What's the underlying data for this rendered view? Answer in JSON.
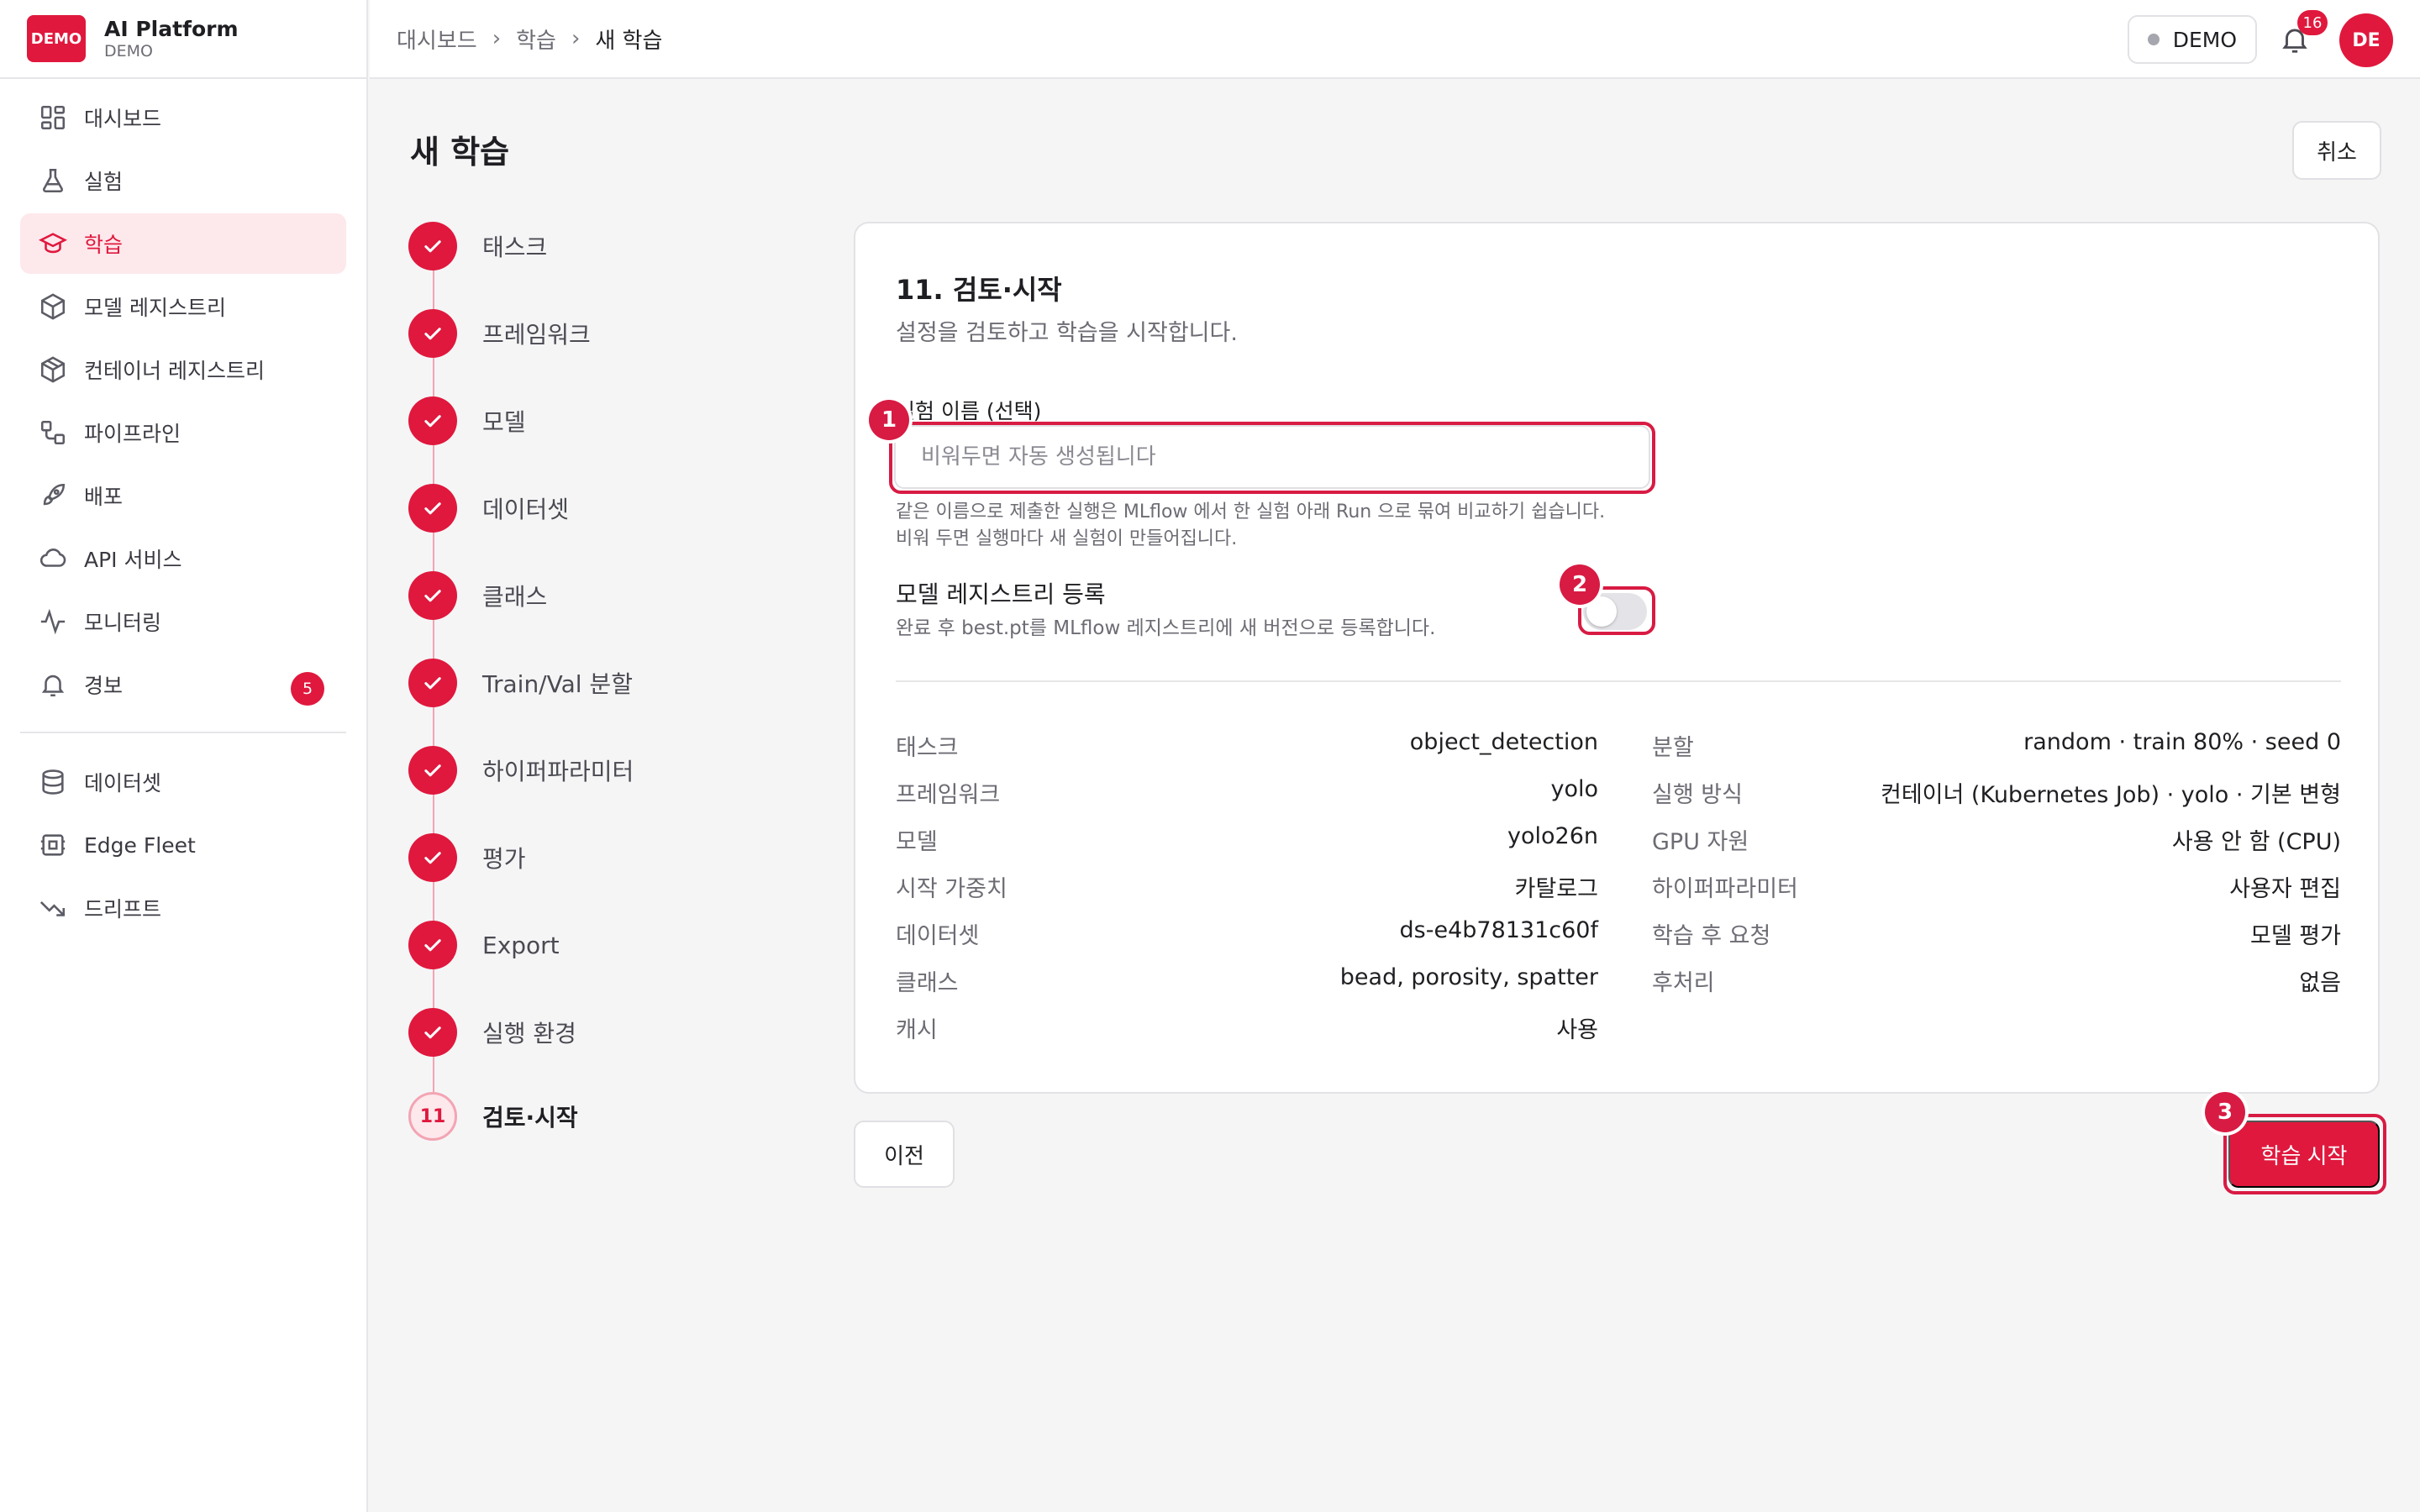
{
  "brand": {
    "logo": "DEMO",
    "title": "AI Platform",
    "subtitle": "DEMO"
  },
  "sidebar": {
    "items": [
      {
        "label": "대시보드",
        "icon": "dashboard-icon"
      },
      {
        "label": "실험",
        "icon": "flask-icon"
      },
      {
        "label": "학습",
        "icon": "graduation-cap-icon",
        "active": true
      },
      {
        "label": "모델 레지스트리",
        "icon": "cube-icon"
      },
      {
        "label": "컨테이너 레지스트리",
        "icon": "container-icon"
      },
      {
        "label": "파이프라인",
        "icon": "pipeline-icon"
      },
      {
        "label": "배포",
        "icon": "rocket-icon"
      },
      {
        "label": "API 서비스",
        "icon": "cloud-icon"
      },
      {
        "label": "모니터링",
        "icon": "activity-icon"
      },
      {
        "label": "경보",
        "icon": "bell-icon",
        "badge": "5"
      }
    ],
    "secondary": [
      {
        "label": "데이터셋",
        "icon": "database-icon"
      },
      {
        "label": "Edge Fleet",
        "icon": "edge-device-icon"
      },
      {
        "label": "드리프트",
        "icon": "trend-down-icon"
      }
    ]
  },
  "header": {
    "breadcrumb": [
      "대시보드",
      "학습",
      "새 학습"
    ],
    "env_label": "DEMO",
    "notification_count": "16",
    "avatar": "DE"
  },
  "page": {
    "title": "새 학습",
    "cancel_label": "취소"
  },
  "steps": [
    {
      "label": "태스크",
      "status": "done"
    },
    {
      "label": "프레임워크",
      "status": "done"
    },
    {
      "label": "모델",
      "status": "done"
    },
    {
      "label": "데이터셋",
      "status": "done"
    },
    {
      "label": "클래스",
      "status": "done"
    },
    {
      "label": "Train/Val 분할",
      "status": "done"
    },
    {
      "label": "하이퍼파라미터",
      "status": "done"
    },
    {
      "label": "평가",
      "status": "done"
    },
    {
      "label": "Export",
      "status": "done"
    },
    {
      "label": "실행 환경",
      "status": "done"
    },
    {
      "label": "검토·시작",
      "status": "current",
      "number": "11"
    }
  ],
  "review": {
    "title": "11. 검토·시작",
    "subtitle": "설정을 검토하고 학습을 시작합니다.",
    "name_label": "실험 이름 (선택)",
    "name_value": "",
    "name_placeholder": "비워두면 자동 생성됩니다",
    "name_hint_1": "같은 이름으로 제출한 실행은 MLflow 에서 한 실험 아래 Run 으로 묶여 비교하기 쉽습니다.",
    "name_hint_2": "비워 두면 실행마다 새 실험이 만들어집니다.",
    "registry_title": "모델 레지스트리 등록",
    "registry_desc": "완료 후 best.pt를 MLflow 레지스트리에 새 버전으로 등록합니다.",
    "registry_enabled": false,
    "summary_left": [
      {
        "key": "태스크",
        "value": "object_detection"
      },
      {
        "key": "프레임워크",
        "value": "yolo"
      },
      {
        "key": "모델",
        "value": "yolo26n"
      },
      {
        "key": "시작 가중치",
        "value": "카탈로그"
      },
      {
        "key": "데이터셋",
        "value": "ds-e4b78131c60f"
      },
      {
        "key": "클래스",
        "value": "bead, porosity, spatter"
      },
      {
        "key": "캐시",
        "value": "사용"
      }
    ],
    "summary_right": [
      {
        "key": "분할",
        "value": "random · train 80% · seed 0"
      },
      {
        "key": "실행 방식",
        "value": "컨테이너 (Kubernetes Job) · yolo · 기본 변형"
      },
      {
        "key": "GPU 자원",
        "value": "사용 안 함 (CPU)"
      },
      {
        "key": "하이퍼파라미터",
        "value": "사용자 편집"
      },
      {
        "key": "학습 후 요청",
        "value": "모델 평가"
      },
      {
        "key": "후처리",
        "value": "없음"
      }
    ]
  },
  "actions": {
    "prev_label": "이전",
    "start_label": "학습 시작"
  },
  "annotations": {
    "marker_1": "1",
    "marker_2": "2",
    "marker_3": "3"
  },
  "colors": {
    "accent": "#e0183d",
    "accent_soft": "#fde8ec",
    "annotation": "#d81b43"
  }
}
